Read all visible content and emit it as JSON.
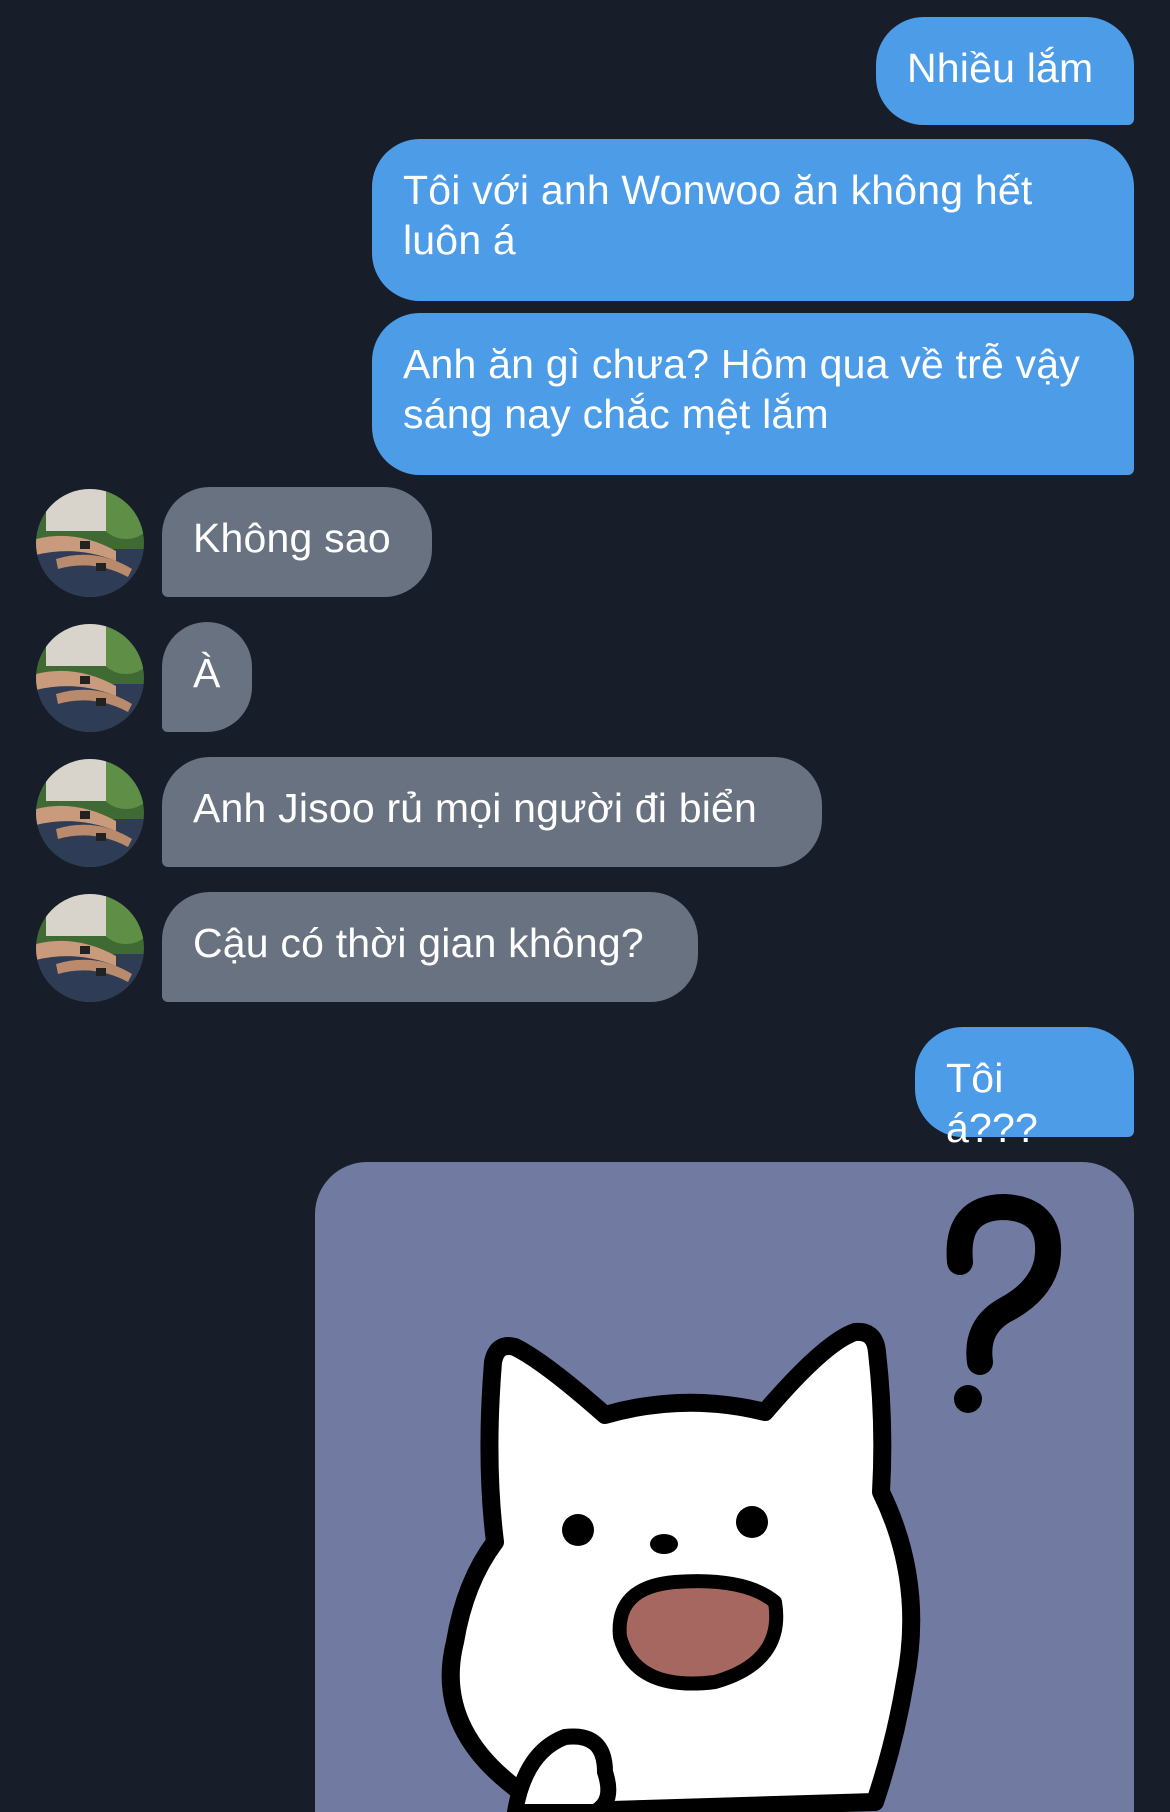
{
  "chat": {
    "messages": [
      {
        "side": "out",
        "text": "Nhiều lắm"
      },
      {
        "side": "out",
        "text": "Tôi với anh Wonwoo ăn không hết luôn á"
      },
      {
        "side": "out",
        "text": "Anh ăn gì chưa? Hôm qua về trễ vậy sáng nay chắc mệt lắm"
      },
      {
        "side": "in",
        "text": "Không sao"
      },
      {
        "side": "in",
        "text": "À"
      },
      {
        "side": "in",
        "text": "Anh Jisoo rủ mọi người đi biển"
      },
      {
        "side": "in",
        "text": "Cậu có thời gian không?"
      },
      {
        "side": "out",
        "text": "Tôi á???"
      }
    ],
    "sticker": {
      "icon": "confused-cat-sticker"
    }
  },
  "colors": {
    "background": "#171e29",
    "outgoing_bubble": "#4d9ce8",
    "incoming_bubble": "#687280",
    "sticker_background": "#717aa1"
  },
  "icons": {
    "avatar": "contact-avatar-photo"
  }
}
